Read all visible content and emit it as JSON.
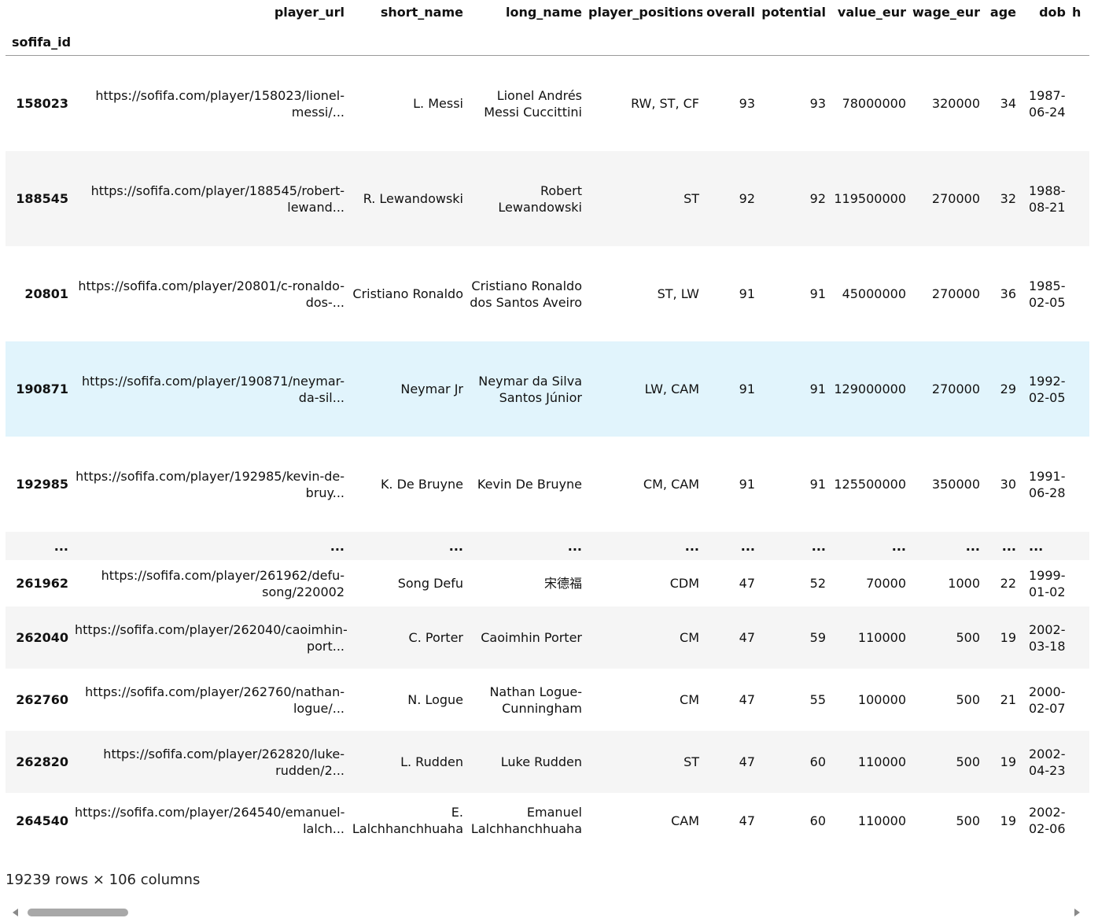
{
  "columns": [
    "player_url",
    "short_name",
    "long_name",
    "player_positions",
    "overall",
    "potential",
    "value_eur",
    "wage_eur",
    "age",
    "dob",
    "h"
  ],
  "index_name": "sofifa_id",
  "rows": [
    {
      "id": "158023",
      "cells": [
        "https://sofifa.com/player/158023/lionel-messi/...",
        "L. Messi",
        "Lionel Andrés Messi Cuccittini",
        "RW, ST, CF",
        "93",
        "93",
        "78000000",
        "320000",
        "34",
        "1987-06-24",
        ""
      ]
    },
    {
      "id": "188545",
      "cells": [
        "https://sofifa.com/player/188545/robert-lewand...",
        "R. Lewandowski",
        "Robert Lewandowski",
        "ST",
        "92",
        "92",
        "119500000",
        "270000",
        "32",
        "1988-08-21",
        ""
      ]
    },
    {
      "id": "20801",
      "cells": [
        "https://sofifa.com/player/20801/c-ronaldo-dos-...",
        "Cristiano Ronaldo",
        "Cristiano Ronaldo dos Santos Aveiro",
        "ST, LW",
        "91",
        "91",
        "45000000",
        "270000",
        "36",
        "1985-02-05",
        ""
      ]
    },
    {
      "id": "190871",
      "cells": [
        "https://sofifa.com/player/190871/neymar-da-sil...",
        "Neymar Jr",
        "Neymar da Silva Santos Júnior",
        "LW, CAM",
        "91",
        "91",
        "129000000",
        "270000",
        "29",
        "1992-02-05",
        ""
      ]
    },
    {
      "id": "192985",
      "cells": [
        "https://sofifa.com/player/192985/kevin-de-bruy...",
        "K. De Bruyne",
        "Kevin De Bruyne",
        "CM, CAM",
        "91",
        "91",
        "125500000",
        "350000",
        "30",
        "1991-06-28",
        ""
      ]
    },
    {
      "id": "...",
      "cells": [
        "...",
        "...",
        "...",
        "...",
        "...",
        "...",
        "...",
        "...",
        "...",
        "...",
        ""
      ]
    },
    {
      "id": "261962",
      "cells": [
        "https://sofifa.com/player/261962/defu-song/220002",
        "Song Defu",
        "宋德福",
        "CDM",
        "47",
        "52",
        "70000",
        "1000",
        "22",
        "1999-01-02",
        ""
      ]
    },
    {
      "id": "262040",
      "cells": [
        "https://sofifa.com/player/262040/caoimhin-port...",
        "C. Porter",
        "Caoimhin Porter",
        "CM",
        "47",
        "59",
        "110000",
        "500",
        "19",
        "2002-03-18",
        ""
      ]
    },
    {
      "id": "262760",
      "cells": [
        "https://sofifa.com/player/262760/nathan-logue/...",
        "N. Logue",
        "Nathan Logue-Cunningham",
        "CM",
        "47",
        "55",
        "100000",
        "500",
        "21",
        "2000-02-07",
        ""
      ]
    },
    {
      "id": "262820",
      "cells": [
        "https://sofifa.com/player/262820/luke-rudden/2...",
        "L. Rudden",
        "Luke Rudden",
        "ST",
        "47",
        "60",
        "110000",
        "500",
        "19",
        "2002-04-23",
        ""
      ]
    },
    {
      "id": "264540",
      "cells": [
        "https://sofifa.com/player/264540/emanuel-lalch...",
        "E. Lalchhanchhuaha",
        "Emanuel Lalchhanchhuaha",
        "CAM",
        "47",
        "60",
        "110000",
        "500",
        "19",
        "2002-02-06",
        ""
      ]
    }
  ],
  "footer": "19239 rows × 106 columns"
}
